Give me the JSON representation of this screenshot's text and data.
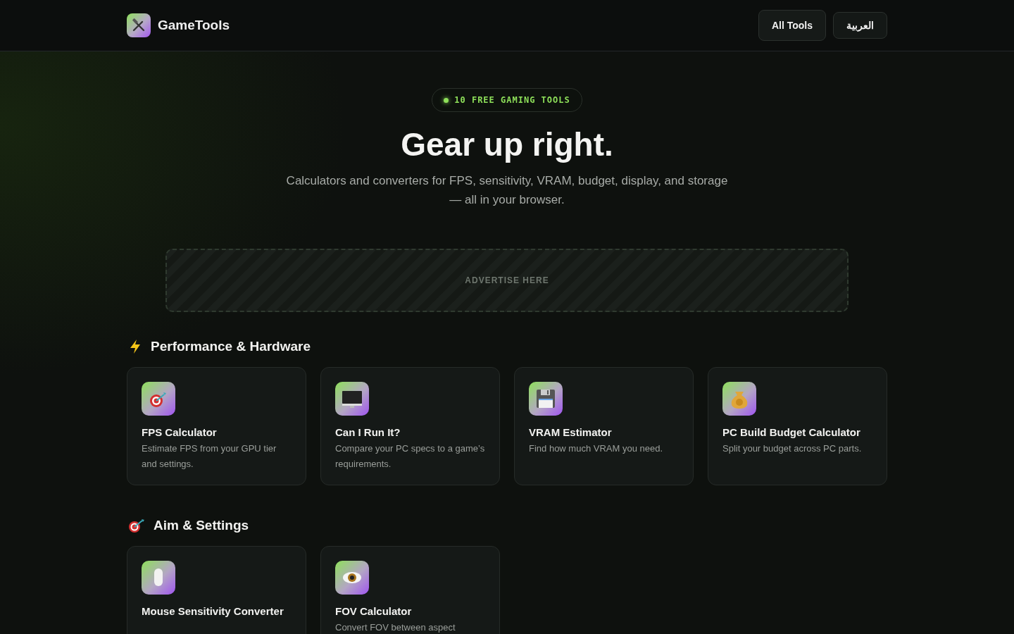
{
  "header": {
    "brand": "GameTools",
    "nav": [
      {
        "label": "All Tools",
        "kind": "primary"
      },
      {
        "label": "العربية",
        "kind": "secondary"
      }
    ]
  },
  "hero": {
    "badge": "10 FREE GAMING TOOLS",
    "title": "Gear up right.",
    "subtitle": "Calculators and converters for FPS, sensitivity, VRAM, budget, display, and storage — all in your browser."
  },
  "ad": {
    "label": "ADVERTISE HERE"
  },
  "sections": [
    {
      "title": "Performance & Hardware",
      "kind": "bolt",
      "tools": [
        {
          "kind": "target",
          "name": "FPS Calculator",
          "description": "Estimate FPS from your GPU tier and settings."
        },
        {
          "kind": "monitor",
          "name": "Can I Run It?",
          "description": "Compare your PC specs to a game’s requirements."
        },
        {
          "kind": "floppy",
          "name": "VRAM Estimator",
          "description": "Find how much VRAM you need."
        },
        {
          "kind": "moneybag",
          "name": "PC Build Budget Calculator",
          "description": "Split your budget across PC parts."
        }
      ]
    },
    {
      "title": "Aim & Settings",
      "kind": "target",
      "tools": [
        {
          "kind": "mouse",
          "name": "Mouse Sensitivity Converter"
        },
        {
          "kind": "eye",
          "name": "FOV Calculator",
          "description": "Convert FOV between aspect"
        }
      ]
    }
  ]
}
